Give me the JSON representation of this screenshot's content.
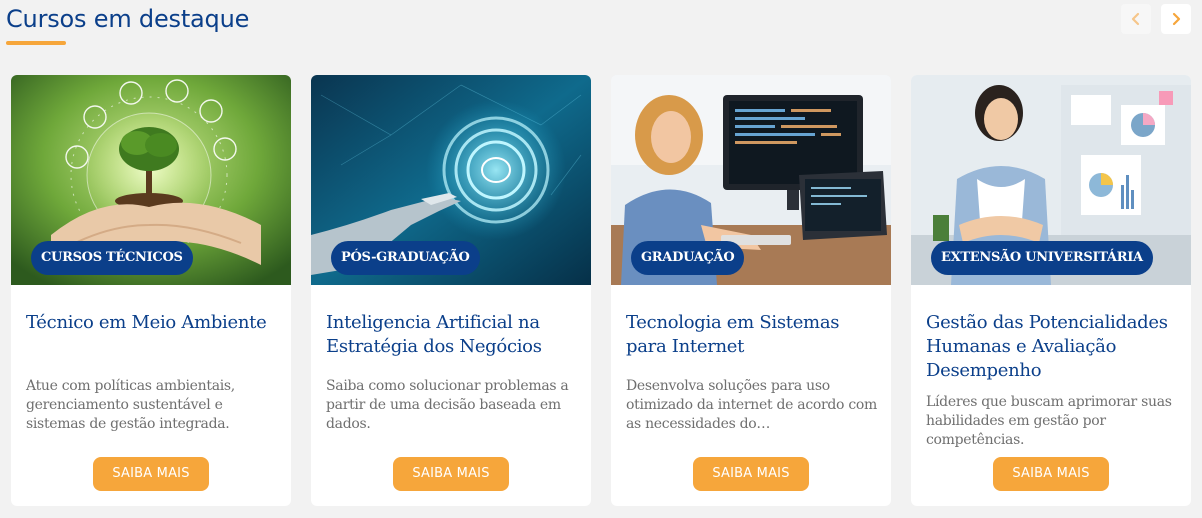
{
  "section": {
    "title": "Cursos em destaque"
  },
  "carousel": {
    "prev_icon": "chevron-left-icon",
    "next_icon": "chevron-right-icon",
    "prev_color": "#f6c68a",
    "next_color": "#f6a63b"
  },
  "colors": {
    "primary": "#0b3f8a",
    "accent": "#f6a63b",
    "text": "#6f6f6f",
    "background": "#f2f2f2"
  },
  "cards": [
    {
      "category": "CURSOS TÉCNICOS",
      "title": "Técnico em Meio Ambiente",
      "description": "Atue com políticas ambientais, gerenciamento sustentável e sistemas de gestão integrada.",
      "button": "SAIBA MAIS"
    },
    {
      "category": "PÓS-GRADUAÇÃO",
      "title": "Inteligencia Artificial na Estratégia dos Negócios",
      "description": "Saiba como solucionar problemas a partir de uma decisão baseada em dados.",
      "button": "SAIBA MAIS"
    },
    {
      "category": "GRADUAÇÃO",
      "title": "Tecnologia em Sistemas para Internet",
      "description": "Desenvolva soluções para uso otimizado da internet de acordo com as necessidades do…",
      "button": "SAIBA MAIS"
    },
    {
      "category": "EXTENSÃO UNIVERSITÁRIA",
      "title": "Gestão das Potencialidades Humanas e Avaliação Desempenho",
      "description": "Líderes que buscam aprimorar suas habilidades em gestão por competências.",
      "button": "SAIBA MAIS"
    }
  ]
}
